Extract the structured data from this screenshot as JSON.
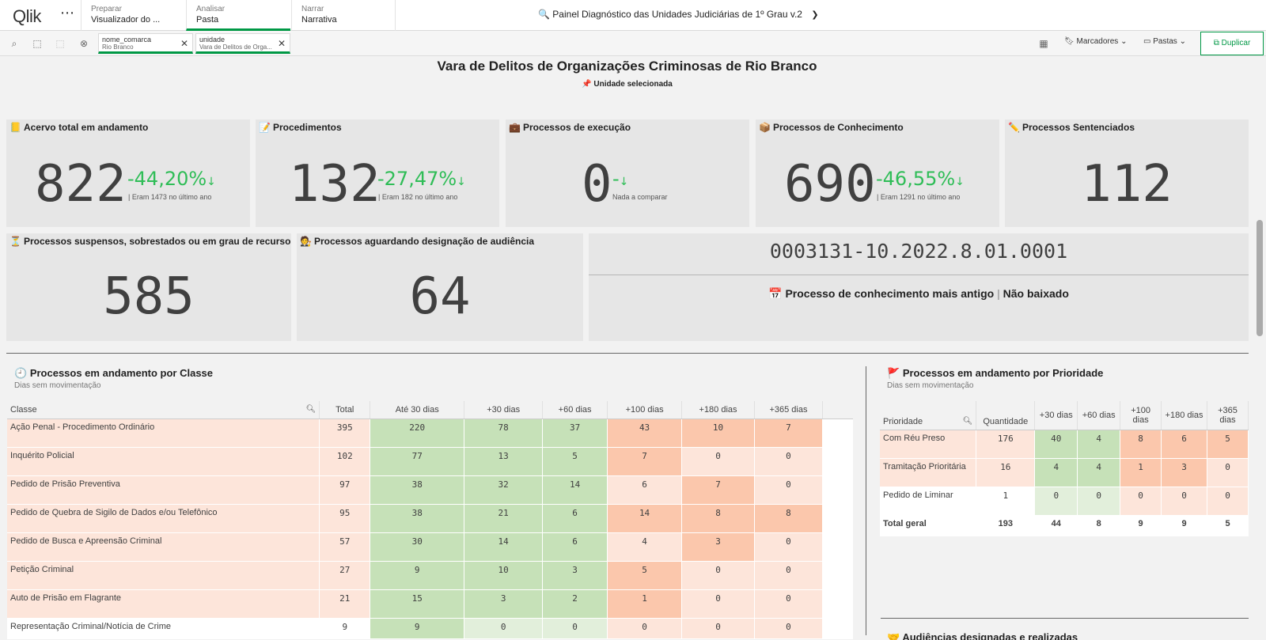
{
  "topbar": {
    "logo": "Qlik",
    "tabs": [
      {
        "small": "Preparar",
        "big": "Visualizador do ..."
      },
      {
        "small": "Analisar",
        "big": "Pasta"
      },
      {
        "small": "Narrar",
        "big": "Narrativa"
      }
    ],
    "app_title": "Painel Diagnóstico das Unidades Judiciárias de 1º Grau v.2"
  },
  "toolbar": {
    "selections": [
      {
        "field": "nome_comarca",
        "value": "Rio Branco"
      },
      {
        "field": "unidade",
        "value": "Vara de Delitos de Orga..."
      }
    ],
    "bookmarks_label": "Marcadores",
    "sheets_label": "Pastas",
    "duplicate_label": "Duplicar"
  },
  "header": {
    "unit_title": "Vara de Delitos de Organizações Criminosas de Rio Branco",
    "unit_subtitle": "Unidade selecionada"
  },
  "kpis": {
    "acervo": {
      "title": "Acervo total em andamento",
      "value": "822",
      "delta": "-44,20%",
      "compare": "| Eram 1473 no último ano"
    },
    "procedimentos": {
      "title": "Procedimentos",
      "value": "132",
      "delta": "-27,47%",
      "compare": "| Eram 182 no último ano"
    },
    "execucao": {
      "title": "Processos de execução",
      "value": "0",
      "delta": "-",
      "compare": "Nada a comparar"
    },
    "conhecimento": {
      "title": "Processos de Conhecimento",
      "value": "690",
      "delta": "-46,55%",
      "compare": "| Eram 1291 no último ano"
    },
    "sentenciados": {
      "title": "Processos Sentenciados",
      "value": "112"
    },
    "suspensos": {
      "title": "Processos suspensos, sobrestados ou em grau de recurso",
      "value": "585"
    },
    "audiencia": {
      "title": "Processos aguardando designação de audiência",
      "value": "64"
    }
  },
  "oldest": {
    "number": "0003131-10.2022.8.01.0001",
    "label": "Processo de conhecimento mais antigo",
    "status": "Não baixado"
  },
  "classe_table": {
    "title": "Processos em andamento por Classe",
    "subtitle": "Dias sem movimentação",
    "headers": [
      "Classe",
      "Total",
      "Até 30 dias",
      "+30 dias",
      "+60 dias",
      "+100 dias",
      "+180 dias",
      "+365 dias"
    ],
    "rows": [
      {
        "label": "Ação Penal - Procedimento Ordinário",
        "vals": [
          "395",
          "220",
          "78",
          "37",
          "43",
          "10",
          "7"
        ]
      },
      {
        "label": "Inquérito Policial",
        "vals": [
          "102",
          "77",
          "13",
          "5",
          "7",
          "0",
          "0"
        ]
      },
      {
        "label": "Pedido de Prisão Preventiva",
        "vals": [
          "97",
          "38",
          "32",
          "14",
          "6",
          "7",
          "0"
        ]
      },
      {
        "label": "Pedido de Quebra de Sigilo de Dados e/ou Telefônico",
        "vals": [
          "95",
          "38",
          "21",
          "6",
          "14",
          "8",
          "8"
        ]
      },
      {
        "label": "Pedido de Busca e Apreensão Criminal",
        "vals": [
          "57",
          "30",
          "14",
          "6",
          "4",
          "3",
          "0"
        ]
      },
      {
        "label": "Petição Criminal",
        "vals": [
          "27",
          "9",
          "10",
          "3",
          "5",
          "0",
          "0"
        ]
      },
      {
        "label": "Auto de Prisão em Flagrante",
        "vals": [
          "21",
          "15",
          "3",
          "2",
          "1",
          "0",
          "0"
        ]
      },
      {
        "label": "Representação Criminal/Notícia de Crime",
        "vals": [
          "9",
          "9",
          "0",
          "0",
          "0",
          "0",
          "0"
        ]
      }
    ]
  },
  "prioridade_table": {
    "title": "Processos em andamento por Prioridade",
    "subtitle": "Dias sem movimentação",
    "headers": [
      "Prioridade",
      "Quantidade",
      "+30 dias",
      "+60 dias",
      "+100 dias",
      "+180 dias",
      "+365 dias"
    ],
    "rows": [
      {
        "label": "Com Réu Preso",
        "vals": [
          "176",
          "40",
          "4",
          "8",
          "6",
          "5"
        ]
      },
      {
        "label": "Tramitação Prioritária",
        "vals": [
          "16",
          "4",
          "4",
          "1",
          "3",
          "0"
        ]
      },
      {
        "label": "Pedido de Liminar",
        "vals": [
          "1",
          "0",
          "0",
          "0",
          "0",
          "0"
        ]
      }
    ],
    "total_label": "Total geral",
    "totals": [
      "193",
      "44",
      "8",
      "9",
      "9",
      "5"
    ]
  },
  "next_section_title": "Audiências designadas e realizadas"
}
